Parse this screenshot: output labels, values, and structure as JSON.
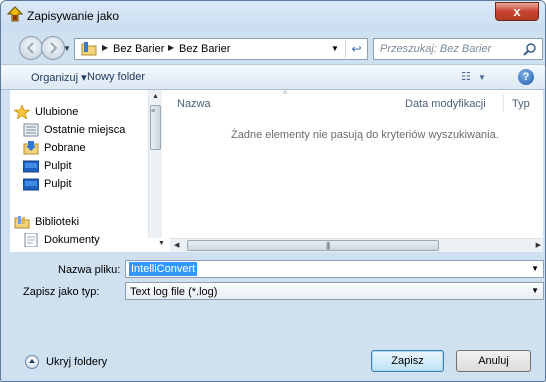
{
  "window": {
    "title": "Zapisywanie jako",
    "close_label": "x"
  },
  "address_bar": {
    "breadcrumbs": [
      "Bez Barier",
      "Bez Barier"
    ]
  },
  "search": {
    "placeholder": "Przeszukaj: Bez Barier"
  },
  "toolbar": {
    "organize_label": "Organizuj ▾",
    "new_folder_label": "Nowy folder",
    "help_label": "?"
  },
  "sidebar": {
    "items": [
      {
        "label": "Ulubione",
        "icon": "star-icon"
      },
      {
        "label": "Ostatnie miejsca",
        "icon": "recent-places-icon"
      },
      {
        "label": "Pobrane",
        "icon": "downloads-icon"
      },
      {
        "label": "Pulpit",
        "icon": "desktop-icon"
      },
      {
        "label": "Pulpit",
        "icon": "desktop-icon"
      },
      {
        "label": "Biblioteki",
        "icon": "libraries-icon"
      },
      {
        "label": "Dokumenty",
        "icon": "documents-icon"
      }
    ]
  },
  "file_list": {
    "columns": [
      "Nazwa",
      "Data modyfikacji",
      "Typ"
    ],
    "empty_message": "Żadne elementy nie pasują do kryteriów wyszukiwania."
  },
  "form": {
    "filename_label": "Nazwa pliku:",
    "filename_value": "IntelliConvert",
    "filetype_label": "Zapisz jako typ:",
    "filetype_value": "Text log file (*.log)"
  },
  "footer": {
    "hide_folders_label": "Ukryj foldery",
    "save_label": "Zapisz",
    "cancel_label": "Anuluj"
  },
  "colors": {
    "frame": "#cfe0f1",
    "selection": "#3399ff",
    "close_button": "#c7432f"
  }
}
